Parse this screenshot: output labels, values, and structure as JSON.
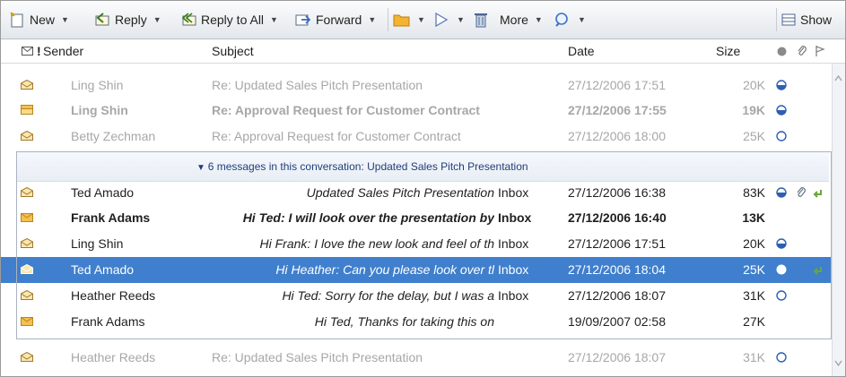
{
  "toolbar": {
    "new_label": "New",
    "reply_label": "Reply",
    "reply_all_label": "Reply to All",
    "forward_label": "Forward",
    "more_label": "More",
    "show_label": "Show"
  },
  "columns": {
    "sender": "Sender",
    "subject": "Subject",
    "date": "Date",
    "size": "Size"
  },
  "conversation_header": "6 messages in this conversation: Updated Sales Pitch Presentation",
  "rows_before": [
    {
      "sender": "Ling Shin",
      "subject": "Re: Updated Sales Pitch Presentation",
      "date": "27/12/2006 17:51",
      "size": "20K",
      "status": "half",
      "bold": false,
      "icon": "open-envelope"
    },
    {
      "sender": "Ling Shin",
      "subject": "Re: Approval Request for Customer Contract",
      "date": "27/12/2006 17:55",
      "size": "19K",
      "status": "half",
      "bold": true,
      "icon": "stack-envelope"
    },
    {
      "sender": "Betty Zechman",
      "subject": "Re: Approval Request for Customer Contract",
      "date": "27/12/2006 18:00",
      "size": "25K",
      "status": "empty",
      "bold": false,
      "icon": "open-envelope"
    }
  ],
  "conversation_rows": [
    {
      "sender": "Ted Amado",
      "subject": "Updated Sales Pitch Presentation",
      "folder": "Inbox",
      "date": "27/12/2006 16:38",
      "size": "83K",
      "status": "half",
      "attachment": true,
      "replied": true,
      "bold": false,
      "selected": false,
      "icon": "open-envelope"
    },
    {
      "sender": "Frank Adams",
      "subject": "Hi Ted: I will look over the presentation by",
      "folder": "Inbox",
      "date": "27/12/2006 16:40",
      "size": "13K",
      "status": "",
      "attachment": false,
      "replied": false,
      "bold": true,
      "selected": false,
      "icon": "closed-envelope"
    },
    {
      "sender": "Ling Shin",
      "subject": "Hi Frank: I love the new look and feel of th",
      "folder": "Inbox",
      "date": "27/12/2006 17:51",
      "size": "20K",
      "status": "half",
      "attachment": false,
      "replied": false,
      "bold": false,
      "selected": false,
      "icon": "open-envelope"
    },
    {
      "sender": "Ted Amado",
      "subject": "Hi Heather: Can you please look over tl",
      "folder": "Inbox",
      "date": "27/12/2006 18:04",
      "size": "25K",
      "status": "full",
      "attachment": false,
      "replied": true,
      "bold": false,
      "selected": true,
      "icon": "open-envelope"
    },
    {
      "sender": "Heather Reeds",
      "subject": "Hi Ted: Sorry for the delay, but I was a",
      "folder": "Inbox",
      "date": "27/12/2006 18:07",
      "size": "31K",
      "status": "empty",
      "attachment": false,
      "replied": false,
      "bold": false,
      "selected": false,
      "icon": "open-envelope"
    },
    {
      "sender": "Frank Adams",
      "subject": "Hi Ted, Thanks for taking this on",
      "folder": "",
      "date": "19/09/2007 02:58",
      "size": "27K",
      "status": "",
      "attachment": false,
      "replied": false,
      "bold": false,
      "selected": false,
      "icon": "closed-envelope"
    }
  ],
  "rows_after": [
    {
      "sender": "Heather Reeds",
      "subject": "Re: Updated Sales Pitch Presentation",
      "date": "27/12/2006 18:07",
      "size": "31K",
      "status": "empty",
      "bold": false,
      "icon": "open-envelope"
    }
  ],
  "colors": {
    "selection": "#3f7fcd",
    "conversation_text": "#1f3e79",
    "dim_text": "#a7a7a7"
  }
}
